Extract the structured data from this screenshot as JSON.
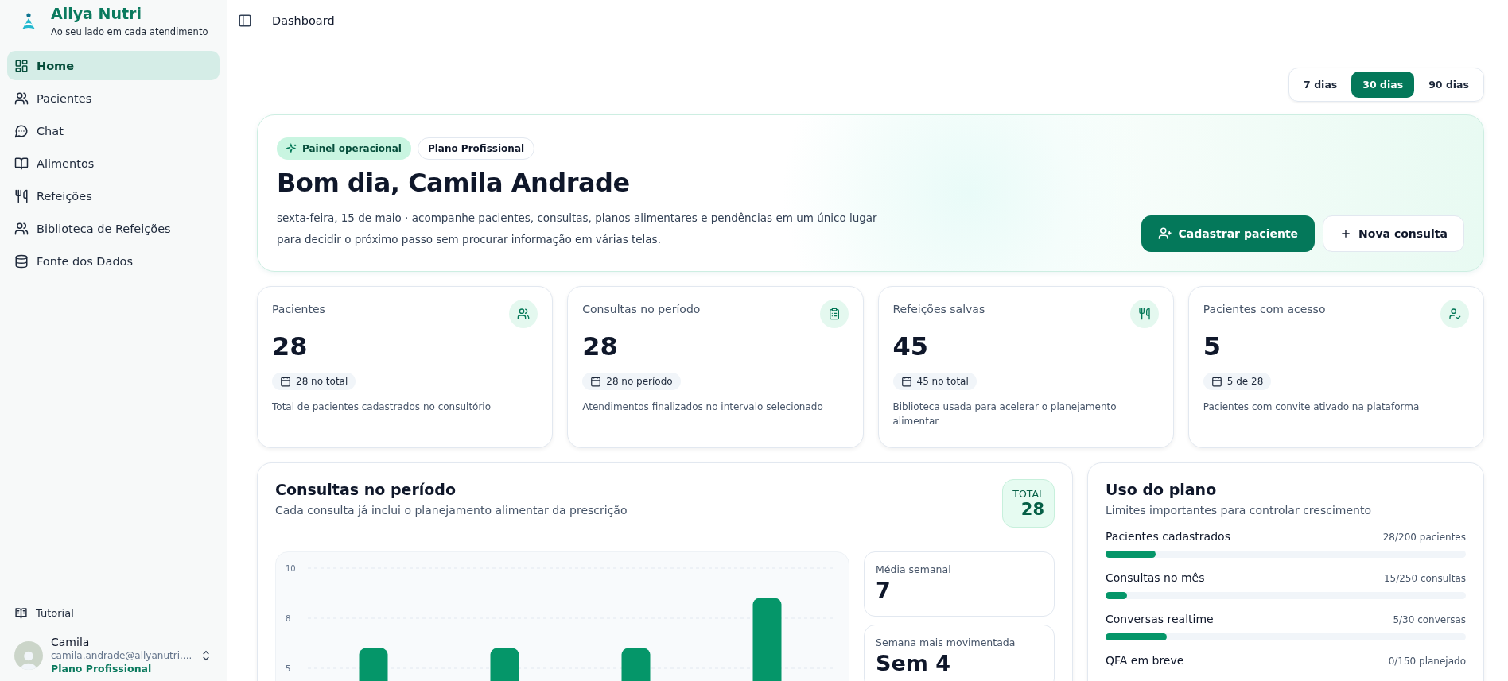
{
  "sidebar": {
    "brand": {
      "name": "Allya Nutri",
      "tagline": "Ao seu lado em cada atendimento"
    },
    "items": [
      {
        "label": "Home",
        "selected": true
      },
      {
        "label": "Pacientes",
        "selected": false
      },
      {
        "label": "Chat",
        "selected": false
      },
      {
        "label": "Alimentos",
        "selected": false
      },
      {
        "label": "Refeições",
        "selected": false
      },
      {
        "label": "Biblioteca de Refeições",
        "selected": false
      },
      {
        "label": "Fonte dos Dados",
        "selected": false
      }
    ],
    "footer_items": [
      {
        "label": "Tutorial"
      }
    ],
    "user": {
      "name": "Camila",
      "email": "camila.andrade@allyanutri....",
      "plan": "Plano Profissional"
    }
  },
  "header": {
    "title": "Dashboard"
  },
  "period_tabs": [
    {
      "label": "7 dias",
      "selected": false
    },
    {
      "label": "30 dias",
      "selected": true
    },
    {
      "label": "90 dias",
      "selected": false
    }
  ],
  "hero": {
    "badges": [
      {
        "label": "Painel operacional",
        "kind": "accent"
      },
      {
        "label": "Plano Profissional",
        "kind": "outline"
      }
    ],
    "title": "Bom dia, Camila Andrade",
    "description": "sexta-feira, 15 de maio · acompanhe pacientes, consultas, planos alimentares e pendências em um único lugar para decidir o próximo passo sem procurar informação em várias telas.",
    "buttons": [
      {
        "label": "Cadastrar paciente",
        "kind": "primary"
      },
      {
        "label": "Nova consulta",
        "kind": "secondary"
      }
    ]
  },
  "stats": [
    {
      "title": "Pacientes",
      "value": "28",
      "chip": "28 no total",
      "description": "Total de pacientes cadastrados no consultório"
    },
    {
      "title": "Consultas no período",
      "value": "28",
      "chip": "28 no período",
      "description": "Atendimentos finalizados no intervalo selecionado"
    },
    {
      "title": "Refeições salvas",
      "value": "45",
      "chip": "45 no total",
      "description": "Biblioteca usada para acelerar o planejamento alimentar"
    },
    {
      "title": "Pacientes com acesso",
      "value": "5",
      "chip": "5 de 28",
      "description": "Pacientes com convite ativado na plataforma"
    }
  ],
  "consultas": {
    "title": "Consultas no período",
    "subtitle": "Cada consulta já inclui o planejamento alimentar da prescrição",
    "total": {
      "label": "TOTAL",
      "value": "28"
    },
    "chart_data": {
      "type": "bar",
      "ylim": [
        0,
        10
      ],
      "yticks": [
        {
          "value": 5,
          "label": "5"
        },
        {
          "value": 7.5,
          "label": "8"
        },
        {
          "value": 10,
          "label": "10"
        }
      ],
      "series": [
        {
          "color": "#059669",
          "values": [
            6,
            6,
            6,
            8.5
          ]
        }
      ]
    },
    "side_stats": [
      {
        "label": "Média semanal",
        "value": "7"
      },
      {
        "label": "Semana mais movimentada",
        "value": "Sem 4"
      }
    ]
  },
  "plan_usage": {
    "title": "Uso do plano",
    "subtitle": "Limites importantes para controlar crescimento",
    "items": [
      {
        "label": "Pacientes cadastrados",
        "reading": "28/200 pacientes",
        "level": 0.14
      },
      {
        "label": "Consultas no mês",
        "reading": "15/250 consultas",
        "level": 0.06
      },
      {
        "label": "Conversas realtime",
        "reading": "5/30 conversas",
        "level": 0.17
      },
      {
        "label": "QFA em breve",
        "reading": "0/150 planejado"
      }
    ]
  }
}
